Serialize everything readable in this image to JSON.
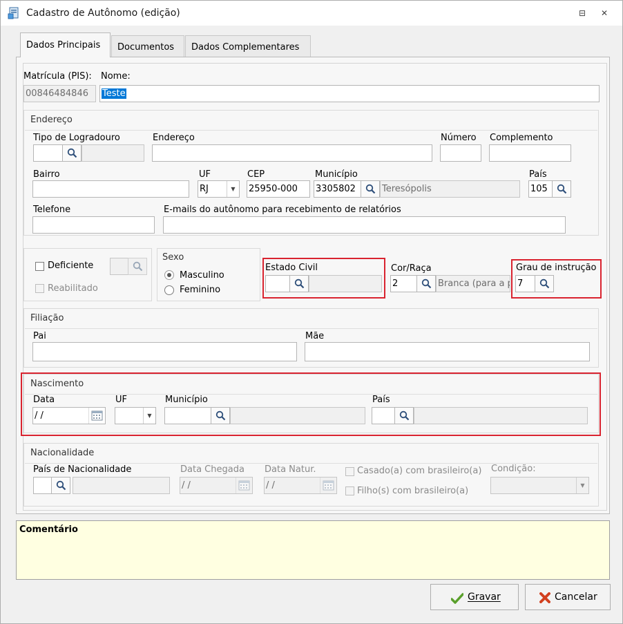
{
  "window": {
    "title": "Cadastro de Autônomo (edição)",
    "minimize_glyph": "⊟",
    "close_glyph": "✕"
  },
  "tabs": [
    {
      "label": "Dados Principais",
      "active": true
    },
    {
      "label": "Documentos",
      "active": false
    },
    {
      "label": "Dados Complementares",
      "active": false
    }
  ],
  "main": {
    "matricula_label": "Matrícula (PIS):",
    "matricula_value": "00846484846",
    "nome_label": "Nome:",
    "nome_value": "Teste"
  },
  "endereco": {
    "title": "Endereço",
    "tipo_logradouro_label": "Tipo de Logradouro",
    "endereco_label": "Endereço",
    "numero_label": "Número",
    "complemento_label": "Complemento",
    "bairro_label": "Bairro",
    "uf_label": "UF",
    "uf_value": "RJ",
    "cep_label": "CEP",
    "cep_value": "25950-000",
    "municipio_label": "Município",
    "municipio_code": "3305802",
    "municipio_name": "Teresópolis",
    "pais_label": "País",
    "pais_value": "105",
    "telefone_label": "Telefone",
    "emails_label": "E-mails do autônomo para recebimento de relatórios"
  },
  "deficiencia": {
    "deficiente_label": "Deficiente",
    "reabilitado_label": "Reabilitado"
  },
  "sexo": {
    "title": "Sexo",
    "masculino_label": "Masculino",
    "feminino_label": "Feminino",
    "selected": "Masculino"
  },
  "estado_civil": {
    "label": "Estado Civil"
  },
  "cor_raca": {
    "label": "Cor/Raça",
    "code": "2",
    "name": "Branca (para a p"
  },
  "grau_instrucao": {
    "label": "Grau de instrução",
    "value": "7"
  },
  "filiacao": {
    "title": "Filiação",
    "pai_label": "Pai",
    "mae_label": "Mãe"
  },
  "nascimento": {
    "title": "Nascimento",
    "data_label": "Data",
    "data_value": " / /",
    "uf_label": "UF",
    "municipio_label": "Município",
    "pais_label": "País"
  },
  "nacionalidade": {
    "title": "Nacionalidade",
    "pais_label": "País de Nacionalidade",
    "data_chegada_label": "Data Chegada",
    "data_chegada_value": " / /",
    "data_natur_label": "Data Natur.",
    "data_natur_value": " / /",
    "casado_label": "Casado(a) com brasileiro(a)",
    "filhos_label": "Filho(s) com brasileiro(a)",
    "condicao_label": "Condição:"
  },
  "comentario": {
    "label": "Comentário"
  },
  "buttons": {
    "gravar_label": "Gravar",
    "cancelar_label": "Cancelar"
  },
  "colors": {
    "highlight": "#d9232f",
    "selection": "#0078d7",
    "comment_bg": "#ffffe1",
    "check_green": "#5aa02c",
    "cancel_red": "#d2401f"
  }
}
